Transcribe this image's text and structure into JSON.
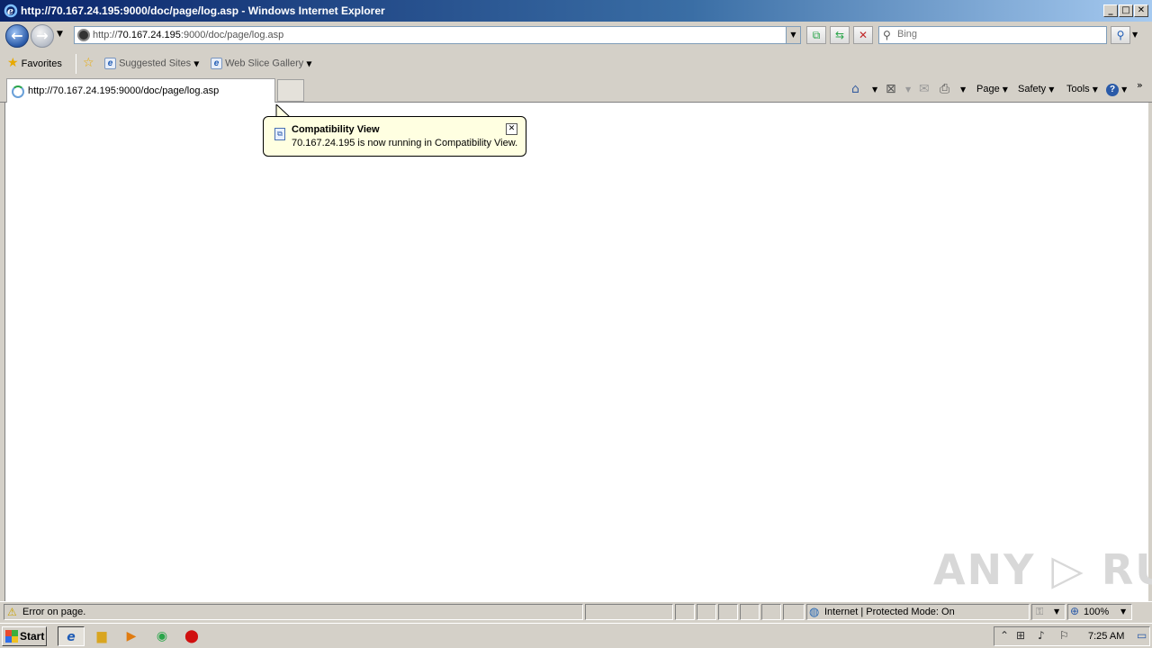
{
  "window": {
    "title": "http://70.167.24.195:9000/doc/page/log.asp - Windows Internet Explorer",
    "minimize": "_",
    "maximize": "□",
    "close": "✕"
  },
  "address": {
    "url_prefix": "http://",
    "url_host": "70.167.24.195",
    "url_rest": ":9000/doc/page/log.asp"
  },
  "search": {
    "placeholder": "Bing"
  },
  "favorites": {
    "label": "Favorites",
    "items": [
      {
        "label": "Suggested Sites"
      },
      {
        "label": "Web Slice Gallery"
      }
    ]
  },
  "tab": {
    "label": "http://70.167.24.195:9000/doc/page/log.asp"
  },
  "commandbar": {
    "page": "Page",
    "safety": "Safety",
    "tools": "Tools"
  },
  "balloon": {
    "title": "Compatibility View",
    "message": "70.167.24.195 is now running in Compatibility View."
  },
  "watermark": "ANY ▷ RUN",
  "status": {
    "message": "Error on page.",
    "zone": "Internet | Protected Mode: On",
    "zoom": "100%"
  },
  "taskbar": {
    "start": "Start",
    "clock": "7:25 AM"
  },
  "icons": [
    "ie-logo-icon",
    "back-icon",
    "forward-icon",
    "refresh-icon",
    "stop-icon",
    "search-icon",
    "star-icon",
    "home-icon",
    "feeds-icon",
    "mail-icon",
    "print-icon",
    "help-icon",
    "warning-icon",
    "globe-icon"
  ]
}
